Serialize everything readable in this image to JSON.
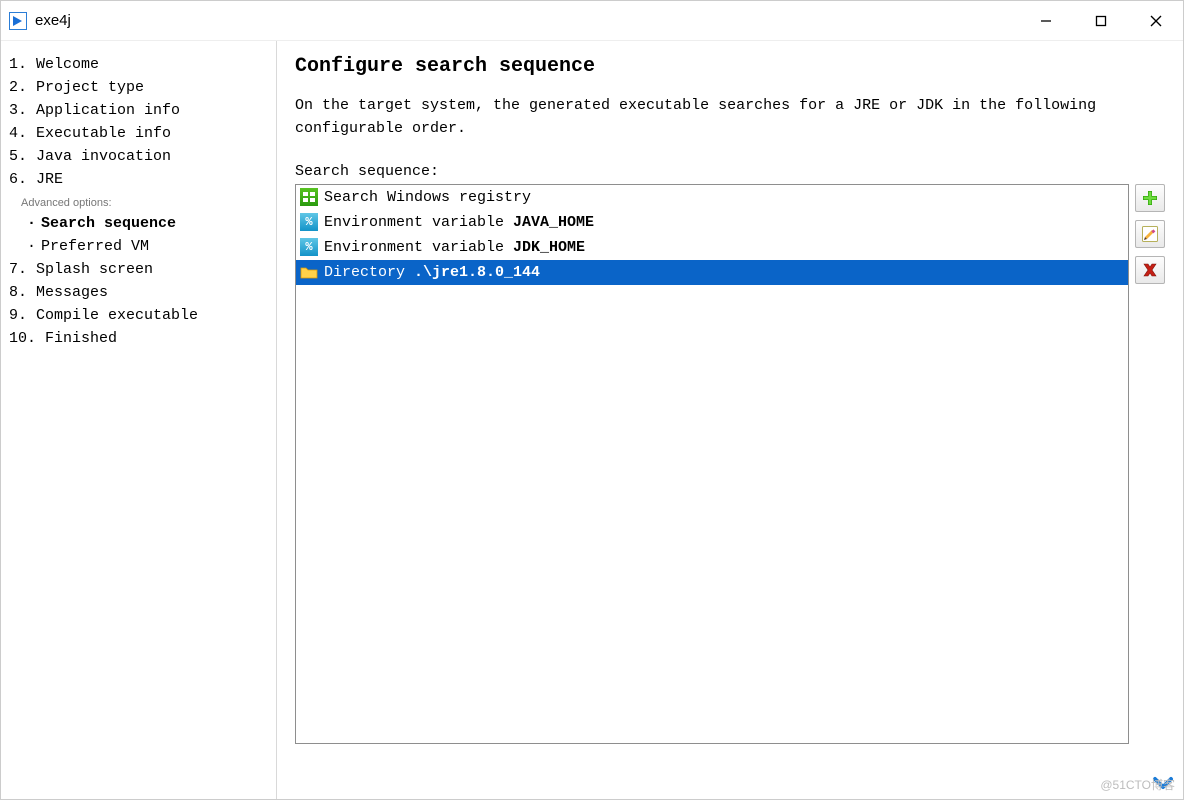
{
  "window": {
    "title": "exe4j"
  },
  "sidebar": {
    "steps": [
      {
        "num": "1.",
        "label": "Welcome"
      },
      {
        "num": "2.",
        "label": "Project type"
      },
      {
        "num": "3.",
        "label": "Application info"
      },
      {
        "num": "4.",
        "label": "Executable info"
      },
      {
        "num": "5.",
        "label": "Java invocation"
      },
      {
        "num": "6.",
        "label": "JRE"
      }
    ],
    "advanced_header": "Advanced options:",
    "sub": [
      {
        "bullet": "·",
        "label": "Search sequence",
        "active": true
      },
      {
        "bullet": "·",
        "label": "Preferred VM",
        "active": false
      }
    ],
    "steps_after": [
      {
        "num": "7.",
        "label": "Splash screen"
      },
      {
        "num": "8.",
        "label": "Messages"
      },
      {
        "num": "9.",
        "label": "Compile executable"
      },
      {
        "num": "10.",
        "label": "Finished"
      }
    ]
  },
  "main": {
    "heading": "Configure search sequence",
    "description": "On the target system, the generated executable searches for a JRE or JDK in the following configurable order.",
    "list_label": "Search sequence:",
    "rows": [
      {
        "icon": "registry",
        "text_prefix": "Search Windows registry",
        "text_bold": "",
        "selected": false
      },
      {
        "icon": "env",
        "text_prefix": "Environment variable ",
        "text_bold": "JAVA_HOME",
        "selected": false
      },
      {
        "icon": "env",
        "text_prefix": "Environment variable ",
        "text_bold": "JDK_HOME",
        "selected": false
      },
      {
        "icon": "folder",
        "text_prefix": "Directory ",
        "text_bold": ".\\jre1.8.0_144",
        "selected": true
      }
    ],
    "buttons": {
      "add_tooltip": "Add",
      "edit_tooltip": "Edit",
      "remove_tooltip": "Remove"
    }
  },
  "watermark": "@51CTO博客"
}
